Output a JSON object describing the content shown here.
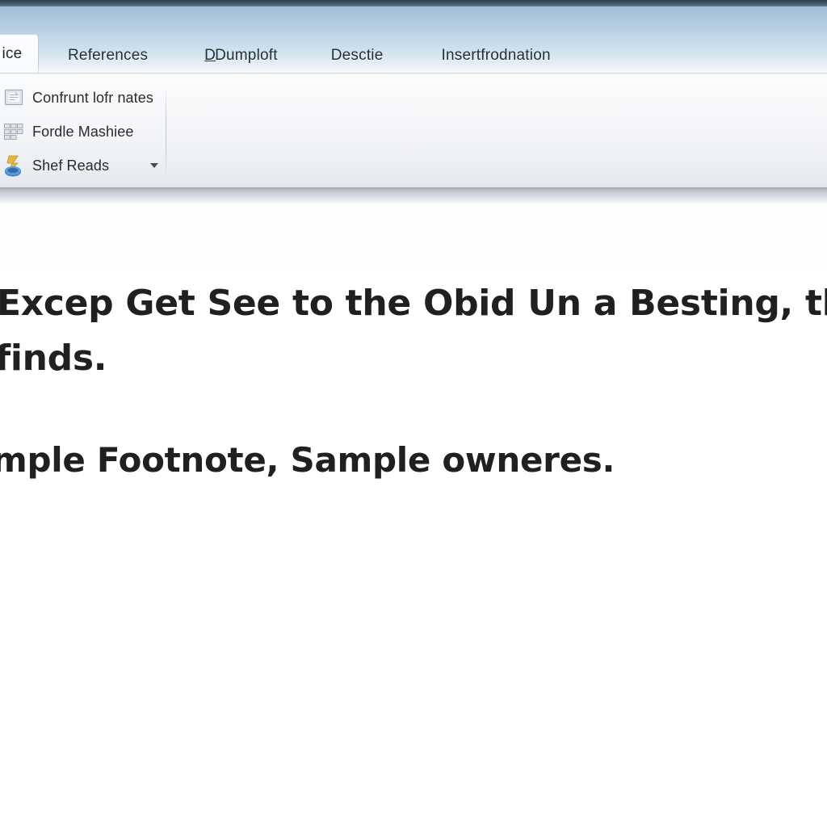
{
  "window": {
    "title_strip_color": "#2e3d4c",
    "ribbon_accent": "#bdd3e6"
  },
  "tabs": [
    {
      "label": "ice",
      "active": true,
      "name": "tab-office",
      "accel": ""
    },
    {
      "label": "References",
      "active": false,
      "name": "tab-references",
      "accel": ""
    },
    {
      "label": "Dumploft",
      "active": false,
      "name": "tab-dumploft",
      "accel": "D"
    },
    {
      "label": "Desctie",
      "active": false,
      "name": "tab-desctie",
      "accel": ""
    },
    {
      "label": "Insertfrodnation",
      "active": false,
      "name": "tab-insertfrodnation",
      "accel": ""
    }
  ],
  "ribbon": {
    "group_items": [
      {
        "label": "Confrunt lofr nates",
        "icon": "insert-endnote-icon",
        "name": "ribbon-item-confrunt-lofr-nates",
        "has_caret": false
      },
      {
        "label": "Fordle Mashiee",
        "icon": "table-grid-icon",
        "name": "ribbon-item-fordle-mashiee",
        "has_caret": false
      },
      {
        "label": "Shef Reads",
        "icon": "show-notes-icon",
        "name": "ribbon-item-shef-reads",
        "has_caret": true
      }
    ]
  },
  "document": {
    "lines": [
      "Excep Get See to the Obid Un a Besting, thes",
      "finds.",
      "mple Footnote, Sample owneres."
    ]
  }
}
